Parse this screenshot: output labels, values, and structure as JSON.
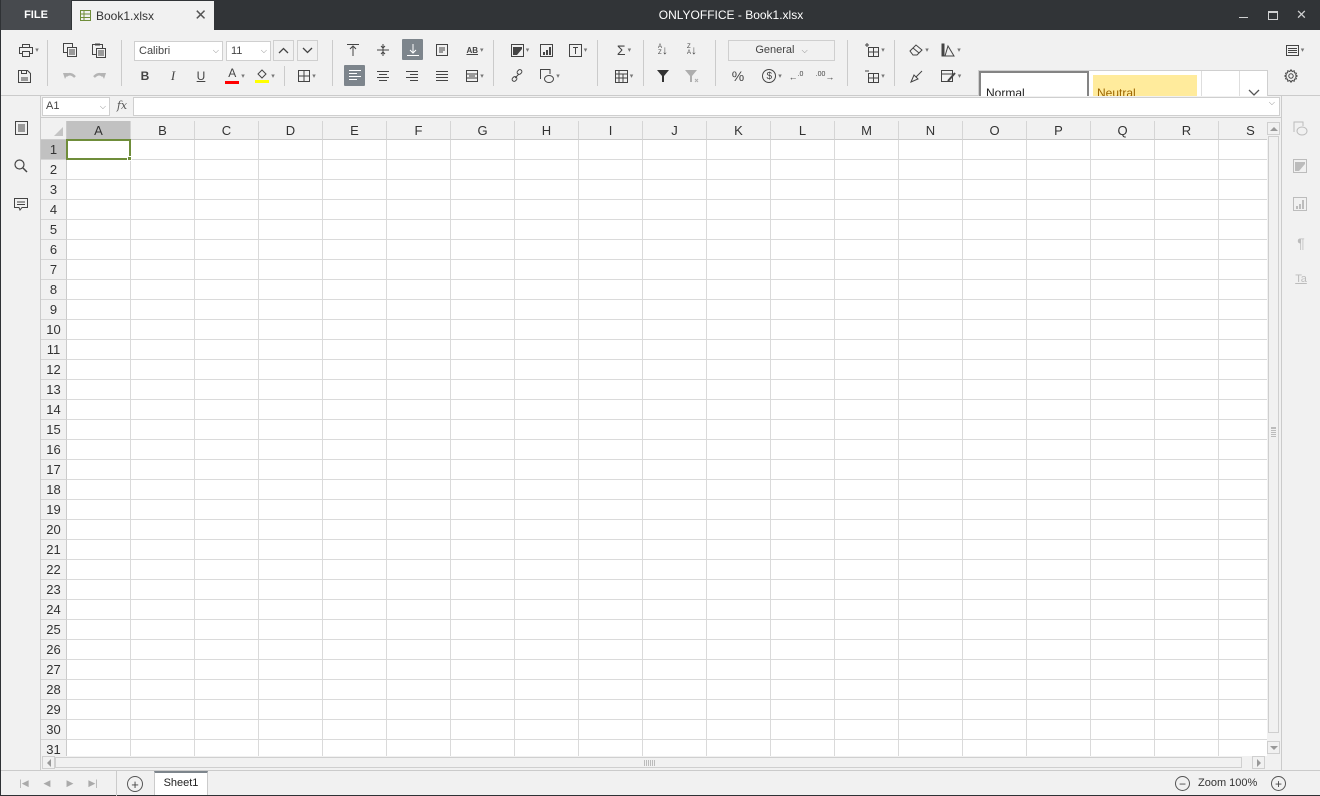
{
  "titlebar": {
    "file_label": "FILE",
    "doc_tab_label": "Book1.xlsx",
    "app_title": "ONLYOFFICE - Book1.xlsx",
    "minimize_icon": "minimize-icon",
    "maximize_icon": "maximize-icon",
    "close_icon": "close-icon"
  },
  "toolbar": {
    "font_name": "Calibri",
    "font_size": "11",
    "number_format": "General",
    "colors": {
      "font_color": "#ff0000",
      "highlight_color": "#ffff00",
      "active_button": "#7d858c"
    },
    "buttons": [
      {
        "name": "print",
        "icon": "printer-icon"
      },
      {
        "name": "save",
        "icon": "save-icon"
      },
      {
        "name": "copy",
        "icon": "copy-icon"
      },
      {
        "name": "paste",
        "icon": "paste-icon"
      },
      {
        "name": "undo",
        "icon": "undo-icon",
        "disabled": true
      },
      {
        "name": "redo",
        "icon": "redo-icon",
        "disabled": true
      },
      {
        "name": "increase-font",
        "icon": "chevron-up-icon"
      },
      {
        "name": "decrease-font",
        "icon": "chevron-down-icon"
      },
      {
        "name": "bold",
        "label": "B"
      },
      {
        "name": "italic",
        "label": "I"
      },
      {
        "name": "underline",
        "label": "U"
      },
      {
        "name": "font-color",
        "label": "A"
      },
      {
        "name": "fill-color",
        "icon": "paint-bucket-icon"
      },
      {
        "name": "borders",
        "icon": "borders-icon"
      },
      {
        "name": "align-top",
        "icon": "align-top-icon"
      },
      {
        "name": "align-middle",
        "icon": "align-middle-icon"
      },
      {
        "name": "align-bottom",
        "icon": "align-bottom-icon",
        "active": true
      },
      {
        "name": "wrap-text",
        "icon": "wrap-text-icon"
      },
      {
        "name": "text-orientation",
        "icon": "text-orientation-icon"
      },
      {
        "name": "align-left",
        "icon": "align-left-icon",
        "active": true
      },
      {
        "name": "align-center",
        "icon": "align-center-icon"
      },
      {
        "name": "align-right",
        "icon": "align-right-icon"
      },
      {
        "name": "justify",
        "icon": "justify-icon"
      },
      {
        "name": "merge",
        "icon": "merge-cells-icon"
      },
      {
        "name": "insert-image",
        "icon": "image-icon"
      },
      {
        "name": "insert-chart",
        "icon": "chart-icon"
      },
      {
        "name": "insert-textbox",
        "icon": "textbox-icon"
      },
      {
        "name": "hyperlink",
        "icon": "link-icon"
      },
      {
        "name": "insert-shape",
        "icon": "shape-icon"
      },
      {
        "name": "autosum",
        "icon": "sigma-icon"
      },
      {
        "name": "named-ranges",
        "icon": "table-icon"
      },
      {
        "name": "sort-asc",
        "icon": "sort-ascending-icon"
      },
      {
        "name": "sort-desc",
        "icon": "sort-descending-icon"
      },
      {
        "name": "filter",
        "icon": "filter-icon"
      },
      {
        "name": "clear-filter",
        "icon": "clear-filter-icon",
        "disabled": true
      },
      {
        "name": "percent",
        "label": "%"
      },
      {
        "name": "currency",
        "icon": "currency-icon"
      },
      {
        "name": "decrease-decimal",
        "icon": "decrease-decimal-icon"
      },
      {
        "name": "increase-decimal",
        "icon": "increase-decimal-icon"
      },
      {
        "name": "insert-cells",
        "icon": "insert-cells-icon"
      },
      {
        "name": "delete-cells",
        "icon": "delete-cells-icon"
      },
      {
        "name": "clear",
        "icon": "eraser-icon"
      },
      {
        "name": "conditional-format",
        "icon": "color-scheme-icon"
      },
      {
        "name": "copy-style",
        "icon": "format-painter-icon"
      },
      {
        "name": "edit-table",
        "icon": "edit-table-icon"
      },
      {
        "name": "view-settings",
        "icon": "view-settings-icon"
      },
      {
        "name": "advanced-settings",
        "icon": "gear-icon"
      }
    ],
    "styles": [
      {
        "label": "Normal",
        "selected": true
      },
      {
        "label": "Neutral",
        "bg": "#ffeb9c",
        "fg": "#9c6500"
      },
      {
        "label": ""
      }
    ]
  },
  "formula_bar": {
    "name_box": "A1",
    "fx_label": "fx",
    "formula": ""
  },
  "left_panel": [
    {
      "name": "document-outline",
      "icon": "outline-icon"
    },
    {
      "name": "search",
      "icon": "search-icon"
    },
    {
      "name": "comments",
      "icon": "comment-icon"
    }
  ],
  "right_panel": [
    {
      "name": "shape-settings",
      "icon": "shape-settings-icon"
    },
    {
      "name": "image-settings",
      "icon": "image-settings-icon"
    },
    {
      "name": "chart-settings",
      "icon": "chart-settings-icon"
    },
    {
      "name": "paragraph-settings",
      "icon": "paragraph-icon"
    },
    {
      "name": "text-art-settings",
      "icon": "text-art-icon"
    }
  ],
  "grid": {
    "columns": [
      "A",
      "B",
      "C",
      "D",
      "E",
      "F",
      "G",
      "H",
      "I",
      "J",
      "K",
      "L",
      "M",
      "N",
      "O",
      "P",
      "Q",
      "R",
      "S"
    ],
    "rows": [
      "1",
      "2",
      "3",
      "4",
      "5",
      "6",
      "7",
      "8",
      "9",
      "10",
      "11",
      "12",
      "13",
      "14",
      "15",
      "16",
      "17",
      "18",
      "19",
      "20",
      "21",
      "22",
      "23",
      "24",
      "25",
      "26",
      "27",
      "28",
      "29",
      "30",
      "31"
    ],
    "selected_cell": "A1",
    "selection_color": "#6f8d3a"
  },
  "statusbar": {
    "sheets": [
      "Sheet1"
    ],
    "active_sheet": "Sheet1",
    "zoom_label": "Zoom 100%"
  }
}
